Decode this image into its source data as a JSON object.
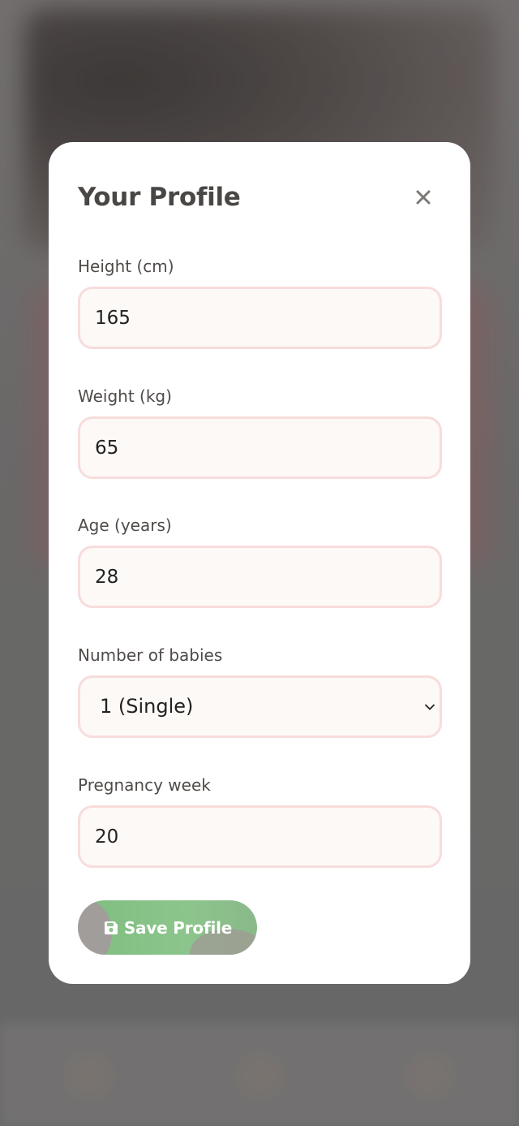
{
  "modal": {
    "title": "Your Profile",
    "close_icon": "close-icon"
  },
  "fields": {
    "height": {
      "label": "Height (cm)",
      "value": "165"
    },
    "weight": {
      "label": "Weight (kg)",
      "value": "65"
    },
    "age": {
      "label": "Age (years)",
      "value": "28"
    },
    "babies": {
      "label": "Number of babies",
      "value": "1 (Single)",
      "icon": "chevron-down-icon"
    },
    "week": {
      "label": "Pregnancy week",
      "value": "20"
    }
  },
  "actions": {
    "save_label": "Save Profile",
    "save_icon": "floppy-disk-icon"
  },
  "colors": {
    "accent_green": "#8cc58c",
    "input_border": "#f8dcdc",
    "input_bg": "#fdf9f6",
    "title_text": "#4a4644"
  }
}
